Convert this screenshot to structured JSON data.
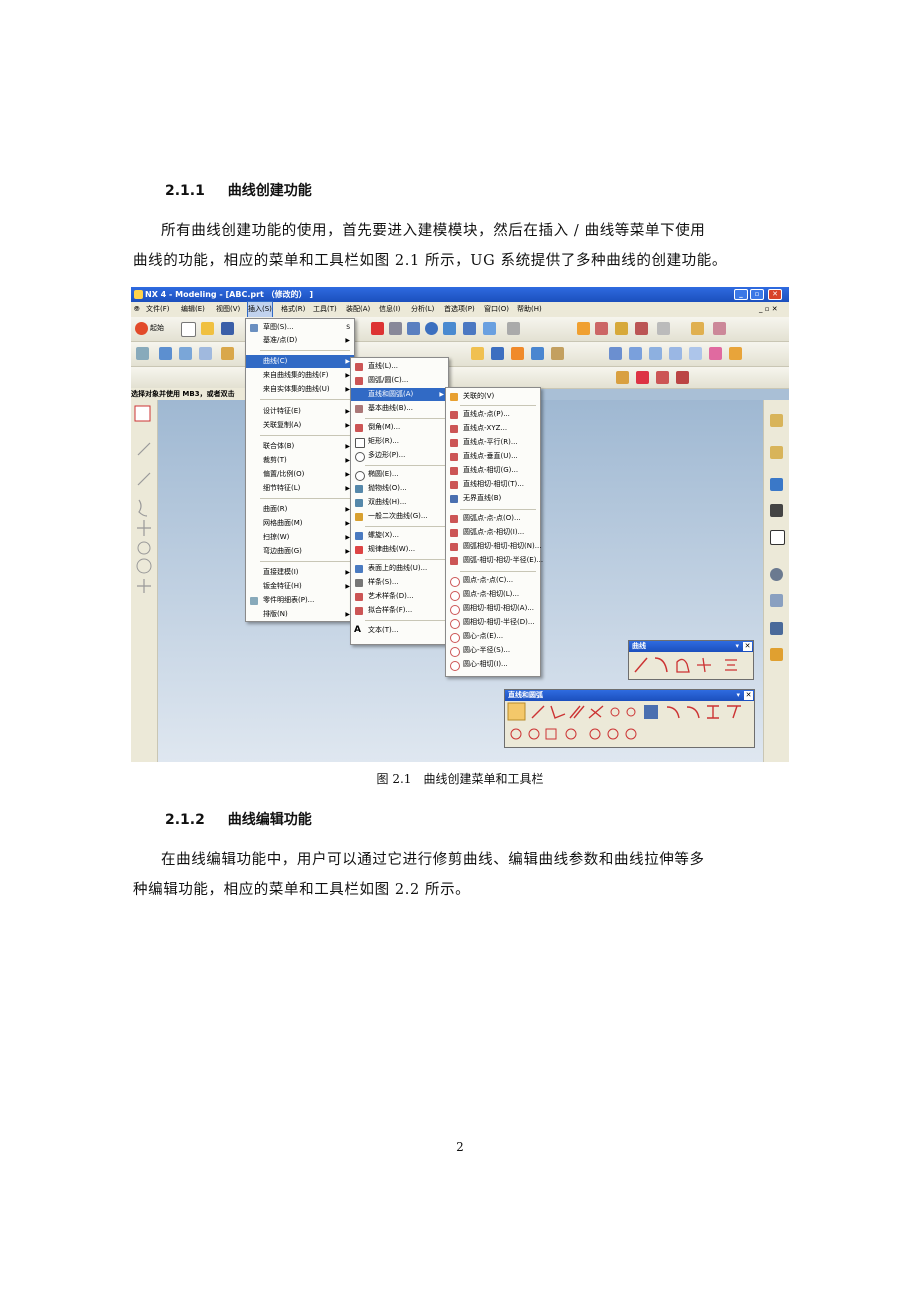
{
  "section_1": {
    "number": "2.1.1",
    "title": "曲线创建功能"
  },
  "para_1": {
    "line1": "所有曲线创建功能的使用，首先要进入建模模块，然后在插入 / 曲线等菜单下使用",
    "line2": "曲线的功能，相应的菜单和工具栏如图 2.1 所示，UG 系统提供了多种曲线的创建功能。"
  },
  "figure": {
    "caption": "图 2.1　曲线创建菜单和工具栏",
    "window_title": "NX 4 - Modeling - [ABC.prt （修改的） ]",
    "menubar": [
      "文件(F)",
      "编辑(E)",
      "视图(V)",
      "插入(S)",
      "格式(R)",
      "工具(T)",
      "装配(A)",
      "信息(I)",
      "分析(L)",
      "首选项(P)",
      "窗口(O)",
      "帮助(H)"
    ],
    "start_label": "起始",
    "status_text": "选择对象并使用 MB3，或者双击",
    "insert_menu": [
      "草图(S)...",
      "基准/点(D)",
      "曲线(C)",
      "来自曲线集的曲线(F)",
      "来自实体集的曲线(U)",
      "设计特征(E)",
      "关联复制(A)",
      "联合体(B)",
      "裁剪(T)",
      "偏置/比例(O)",
      "细节特征(L)",
      "曲面(R)",
      "网格曲面(M)",
      "扫掠(W)",
      "弯边曲面(G)",
      "直接建模(I)",
      "钣金特征(H)",
      "零件明细表(P)...",
      "排版(N)"
    ],
    "sketch_shortcut": "S",
    "curve_menu": [
      "直线(L)...",
      "圆弧/圆(C)...",
      "直线和圆弧(A)",
      "基本曲线(B)...",
      "倒角(M)...",
      "矩形(R)...",
      "多边形(P)...",
      "椭圆(E)...",
      "抛物线(O)...",
      "双曲线(H)...",
      "一般二次曲线(G)...",
      "螺旋(X)...",
      "规律曲线(W)...",
      "表面上的曲线(U)...",
      "样条(S)...",
      "艺术样条(D)...",
      "拟合样条(F)...",
      "文本(T)..."
    ],
    "line_arc_menu": [
      "关联的(V)",
      "直线点-点(P)...",
      "直线点-XYZ...",
      "直线点-平行(R)...",
      "直线点-垂直(U)...",
      "直线点-相切(G)...",
      "直线相切-相切(T)...",
      "无界直线(B)",
      "圆弧点-点-点(O)...",
      "圆弧点-点-相切(I)...",
      "圆弧相切-相切-相切(N)...",
      "圆弧-相切-相切-半径(E)...",
      "圆点-点-点(C)...",
      "圆点-点-相切(L)...",
      "圆相切-相切-相切(A)...",
      "圆相切-相切-半径(D)...",
      "圆心-点(E)...",
      "圆心-半径(S)...",
      "圆心-相切(I)..."
    ],
    "palette_curve": "曲线",
    "palette_line_arc": "直线和圆弧"
  },
  "section_2": {
    "number": "2.1.2",
    "title": "曲线编辑功能"
  },
  "para_2": {
    "line1": "在曲线编辑功能中，用户可以通过它进行修剪曲线、编辑曲线参数和曲线拉伸等多",
    "line2": "种编辑功能，相应的菜单和工具栏如图 2.2 所示。"
  },
  "page_number": "2"
}
